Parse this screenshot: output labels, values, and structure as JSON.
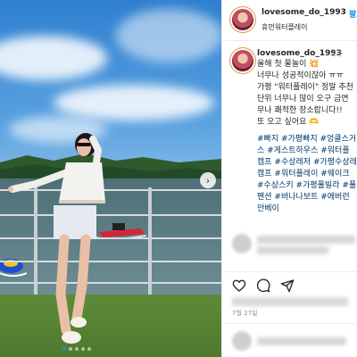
{
  "header": {
    "username": "lovesome_do_1993",
    "follow_label": "팔로",
    "location": "휴먼워터플레이"
  },
  "caption": {
    "username": "lovesome_do_1993",
    "time_ago": "2주",
    "lines": [
      "올해 첫 물놀이 💥",
      "너무나 성공적이잖아 ㅠㅠ",
      "가평 \"워터플레이\" 정말 추천",
      "단위 너무나 많이 오구 금연",
      "무나 쾌적한 장소랍니다!!",
      "또 오고 싶어요 🫶"
    ],
    "hashtags": [
      "#빠지 #가평빠지 #엉클스거",
      "스 #게스트하우스 #워터플",
      "캠프 #수상레저 #가평수상레",
      "캠프 #워터플레이 #웨이크",
      "#수상스키 #가평풀빌라 #풀",
      "펜션 #바나나보트 #에버런",
      "안베이"
    ]
  },
  "post": {
    "date": "7월 27일",
    "carousel_dots": 5,
    "active_dot": 0
  },
  "icons": {
    "like": "heart-icon",
    "comment": "comment-icon",
    "share": "send-icon",
    "next": "chevron-right-icon"
  },
  "colors": {
    "link": "#00376b",
    "follow": "#0095f6",
    "text": "#262626",
    "muted": "#8e8e8e"
  }
}
